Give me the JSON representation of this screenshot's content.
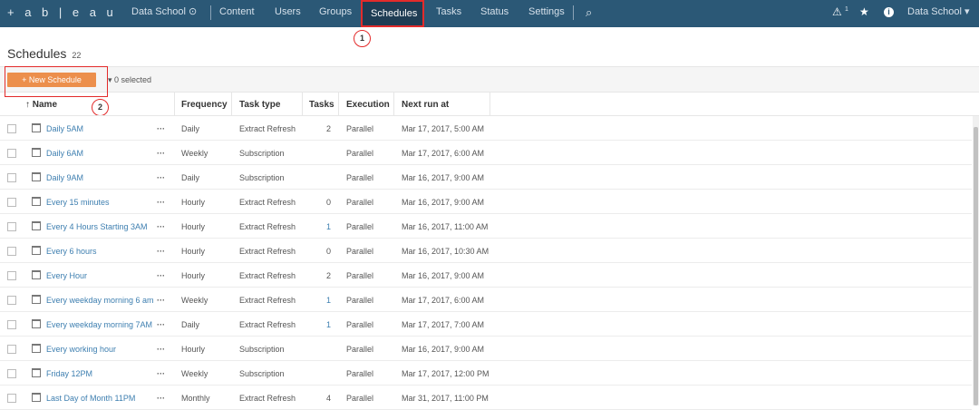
{
  "nav": {
    "logo": "+ a b | e a u",
    "site": "Data School ⊙",
    "items": [
      "Content",
      "Users",
      "Groups",
      "Schedules",
      "Tasks",
      "Status",
      "Settings"
    ],
    "active": "Schedules",
    "alert_count": "1",
    "user": "Data School ▾"
  },
  "annotations": {
    "one": "1",
    "two": "2"
  },
  "page": {
    "title": "Schedules",
    "count": "22"
  },
  "toolbar": {
    "new_schedule": "+ New Schedule",
    "selected": "▾ 0 selected"
  },
  "columns": {
    "name": "↑ Name",
    "frequency": "Frequency",
    "task_type": "Task type",
    "tasks": "Tasks",
    "execution": "Execution",
    "next_run": "Next run at"
  },
  "rows": [
    {
      "name": "Daily 5AM",
      "frequency": "Daily",
      "task_type": "Extract Refresh",
      "tasks": "2",
      "execution": "Parallel",
      "next_run": "Mar 17, 2017, 5:00 AM"
    },
    {
      "name": "Daily 6AM",
      "frequency": "Weekly",
      "task_type": "Subscription",
      "tasks": "",
      "execution": "Parallel",
      "next_run": "Mar 17, 2017, 6:00 AM"
    },
    {
      "name": "Daily 9AM",
      "frequency": "Daily",
      "task_type": "Subscription",
      "tasks": "",
      "execution": "Parallel",
      "next_run": "Mar 16, 2017, 9:00 AM"
    },
    {
      "name": "Every 15 minutes",
      "frequency": "Hourly",
      "task_type": "Extract Refresh",
      "tasks": "0",
      "execution": "Parallel",
      "next_run": "Mar 16, 2017, 9:00 AM"
    },
    {
      "name": "Every 4 Hours Starting 3AM",
      "frequency": "Hourly",
      "task_type": "Extract Refresh",
      "tasks": "1",
      "execution": "Parallel",
      "next_run": "Mar 16, 2017, 11:00 AM"
    },
    {
      "name": "Every 6 hours",
      "frequency": "Hourly",
      "task_type": "Extract Refresh",
      "tasks": "0",
      "execution": "Parallel",
      "next_run": "Mar 16, 2017, 10:30 AM"
    },
    {
      "name": "Every Hour",
      "frequency": "Hourly",
      "task_type": "Extract Refresh",
      "tasks": "2",
      "execution": "Parallel",
      "next_run": "Mar 16, 2017, 9:00 AM"
    },
    {
      "name": "Every weekday morning 6 am",
      "frequency": "Weekly",
      "task_type": "Extract Refresh",
      "tasks": "1",
      "execution": "Parallel",
      "next_run": "Mar 17, 2017, 6:00 AM"
    },
    {
      "name": "Every weekday morning 7AM",
      "frequency": "Daily",
      "task_type": "Extract Refresh",
      "tasks": "1",
      "execution": "Parallel",
      "next_run": "Mar 17, 2017, 7:00 AM"
    },
    {
      "name": "Every working hour",
      "frequency": "Hourly",
      "task_type": "Subscription",
      "tasks": "",
      "execution": "Parallel",
      "next_run": "Mar 16, 2017, 9:00 AM"
    },
    {
      "name": "Friday 12PM",
      "frequency": "Weekly",
      "task_type": "Subscription",
      "tasks": "",
      "execution": "Parallel",
      "next_run": "Mar 17, 2017, 12:00 PM"
    },
    {
      "name": "Last Day of Month 11PM",
      "frequency": "Monthly",
      "task_type": "Extract Refresh",
      "tasks": "4",
      "execution": "Parallel",
      "next_run": "Mar 31, 2017, 11:00 PM"
    }
  ]
}
